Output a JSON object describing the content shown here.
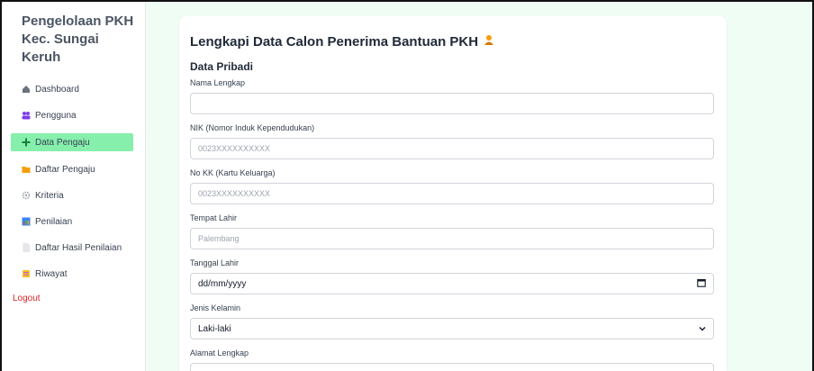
{
  "sidebar": {
    "brand": {
      "line1": "Pengelolaan PKH",
      "line2": "Kec. Sungai Keruh"
    },
    "items": [
      {
        "label": "Dashboard",
        "icon": "home-icon",
        "active": false
      },
      {
        "label": "Pengguna",
        "icon": "users-icon",
        "active": false
      },
      {
        "label": "Data Pengaju",
        "icon": "plus-icon",
        "active": true
      },
      {
        "label": "Daftar Pengaju",
        "icon": "folder-icon",
        "active": false
      },
      {
        "label": "Kriteria",
        "icon": "gear-icon",
        "active": false
      },
      {
        "label": "Penilaian",
        "icon": "chart-icon",
        "active": false
      },
      {
        "label": "Daftar Hasil Penilaian",
        "icon": "document-icon",
        "active": false
      },
      {
        "label": "Riwayat",
        "icon": "history-icon",
        "active": false
      }
    ],
    "logout": "Logout"
  },
  "form": {
    "title": "Lengkapi Data Calon Penerima Bantuan PKH",
    "title_icon": "person-icon",
    "section": "Data Pribadi",
    "fields": [
      {
        "label": "Nama Lengkap",
        "value": "",
        "placeholder": ""
      },
      {
        "label": "NIK (Nomor Induk Kependudukan)",
        "value": "",
        "placeholder": "0023XXXXXXXXXX"
      },
      {
        "label": "No KK (Kartu Keluarga)",
        "value": "",
        "placeholder": "0023XXXXXXXXXX"
      },
      {
        "label": "Tempat Lahir",
        "value": "",
        "placeholder": "Palembang"
      },
      {
        "label": "Tanggal Lahir",
        "value": "dd/mm/yyyy",
        "placeholder": ""
      },
      {
        "label": "Jenis Kelamin",
        "value": "Laki-laki",
        "placeholder": ""
      },
      {
        "label": "Alamat Lengkap",
        "value": "",
        "placeholder": ""
      }
    ]
  },
  "colors": {
    "active_nav": "#86efac",
    "main_bg": "#f0fdf4",
    "logout": "#dc2626"
  }
}
